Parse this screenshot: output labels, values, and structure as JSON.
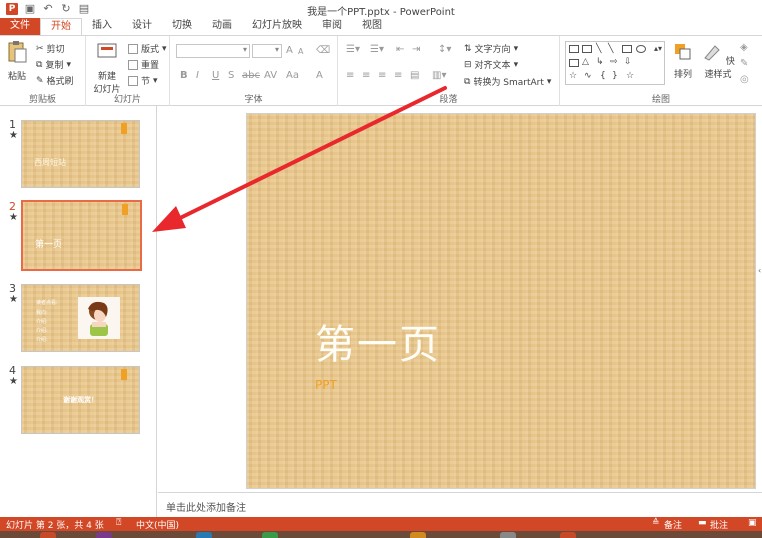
{
  "window": {
    "title": "我是一个PPT.pptx - PowerPoint"
  },
  "tabs": [
    {
      "label": "文件"
    },
    {
      "label": "开始"
    },
    {
      "label": "插入"
    },
    {
      "label": "设计"
    },
    {
      "label": "切换"
    },
    {
      "label": "动画"
    },
    {
      "label": "幻灯片放映"
    },
    {
      "label": "审阅"
    },
    {
      "label": "视图"
    }
  ],
  "ribbon": {
    "clipboard": {
      "paste": "粘贴",
      "cut": "剪切",
      "copy": "复制",
      "format_painter": "格式刷",
      "label": "剪贴板"
    },
    "slides": {
      "new_slide_1": "新建",
      "new_slide_2": "幻灯片",
      "layout": "版式",
      "reset": "重置",
      "section": "节",
      "label": "幻灯片"
    },
    "font": {
      "label": "字体",
      "bold": "B",
      "italic": "I",
      "underline": "U",
      "shadow": "S",
      "strike": "abc",
      "spacing": "AV",
      "case": "Aa",
      "color": "A",
      "grow": "A",
      "shrink": "A"
    },
    "paragraph": {
      "text_direction": "文字方向",
      "align_text": "对齐文本",
      "smartart": "转换为 SmartArt",
      "label": "段落"
    },
    "drawing": {
      "arrange": "排列",
      "quick_styles": "快速样式",
      "label": "绘图"
    }
  },
  "thumbnails": [
    {
      "num": "1",
      "star": "★",
      "text": "西周短站"
    },
    {
      "num": "2",
      "star": "★",
      "text": "第一页"
    },
    {
      "num": "3",
      "star": "★",
      "lines": [
        "读者点看:",
        "我向:",
        "介绍:",
        "介绍:",
        "介绍:"
      ]
    },
    {
      "num": "4",
      "star": "★",
      "text": "谢谢观赏！"
    }
  ],
  "slide": {
    "title": "第一页",
    "subtitle": "PPT"
  },
  "notes": {
    "placeholder": "单击此处添加备注"
  },
  "status": {
    "slide_info": "幻灯片 第 2 张，共 4 张",
    "language": "中文(中国)",
    "notes": "备注",
    "comments": "批注"
  },
  "colors": {
    "accent": "#d24726",
    "wood": "#e9c688",
    "tag": "#f0a024",
    "arrow": "#e8282d"
  }
}
